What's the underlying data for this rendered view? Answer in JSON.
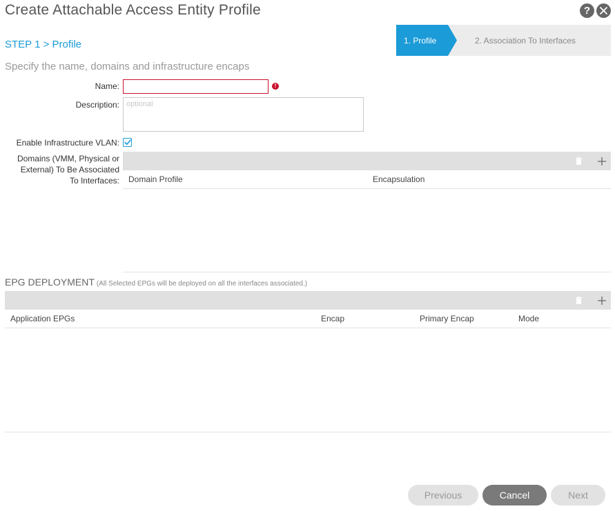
{
  "header": {
    "title": "Create Attachable Access Entity Profile",
    "help_icon": "question-icon",
    "close_icon": "close-icon"
  },
  "step": {
    "label": "STEP 1 > Profile"
  },
  "wizard": {
    "steps": [
      {
        "label": "1. Profile",
        "active": true
      },
      {
        "label": "2. Association To Interfaces",
        "active": false
      }
    ]
  },
  "subtitle": "Specify the name, domains and infrastructure encaps",
  "form": {
    "name_label": "Name:",
    "name_value": "",
    "name_error": "!",
    "description_label": "Description:",
    "description_placeholder": "optional",
    "infra_vlan_label": "Enable Infrastructure VLAN:",
    "infra_vlan_checked": true,
    "domains_label_line1": "Domains (VMM, Physical or",
    "domains_label_line2": "External) To Be Associated",
    "domains_label_line3": "To Interfaces:"
  },
  "domains_table": {
    "columns": [
      "Domain Profile",
      "Encapsulation"
    ],
    "rows": []
  },
  "epg": {
    "title": "EPG DEPLOYMENT",
    "note": "(All Selected EPGs will be deployed on all the interfaces associated.)",
    "columns": [
      "Application EPGs",
      "Encap",
      "Primary Encap",
      "Mode"
    ],
    "rows": []
  },
  "footer": {
    "previous_label": "Previous",
    "cancel_label": "Cancel",
    "next_label": "Next"
  },
  "colors": {
    "accent": "#1b9bd7",
    "error": "#c8102e",
    "cancel_bg": "#7a7a7a",
    "disabled_bg": "#e2e2e2"
  }
}
